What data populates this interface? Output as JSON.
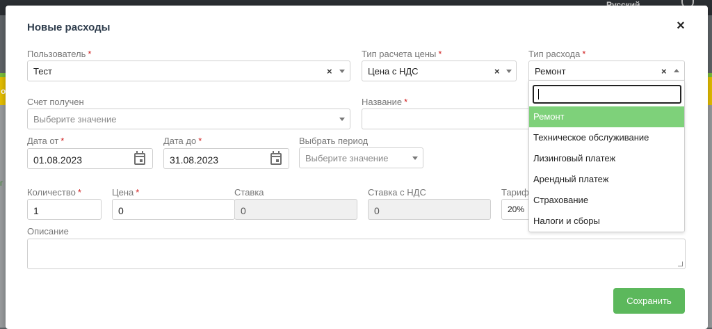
{
  "background": {
    "language_label": "Русский",
    "letter_o": "о",
    "letter_g": "г"
  },
  "modal": {
    "title": "Новые расходы",
    "close_label": "×",
    "required_mark": "*"
  },
  "fields": {
    "user": {
      "label": "Пользователь",
      "value": "Тест"
    },
    "price_type": {
      "label": "Тип расчета цены",
      "value": "Цена с НДС"
    },
    "expense_type": {
      "label": "Тип расхода",
      "value": "Ремонт"
    },
    "invoice": {
      "label": "Счет получен",
      "placeholder": "Выберите значение"
    },
    "name": {
      "label": "Название",
      "value": ""
    },
    "date_from": {
      "label": "Дата от",
      "value": "01.08.2023"
    },
    "date_to": {
      "label": "Дата до",
      "value": "31.08.2023"
    },
    "period": {
      "label": "Выбрать период",
      "placeholder": "Выберите значение"
    },
    "quantity": {
      "label": "Количество",
      "value": "1"
    },
    "price": {
      "label": "Цена",
      "value": "0"
    },
    "rate": {
      "label": "Ставка",
      "value": "0"
    },
    "rate_vat": {
      "label": "Ставка с НДС",
      "value": "0"
    },
    "tariff": {
      "label": "Тариф",
      "value": "20%"
    },
    "description": {
      "label": "Описание",
      "value": ""
    }
  },
  "dropdown": {
    "search_value": "",
    "options": [
      "Ремонт",
      "Техническое обслуживание",
      "Лизинговый платеж",
      "Арендный платеж",
      "Страхование",
      "Налоги и сборы"
    ],
    "selected_index": 0
  },
  "actions": {
    "save_label": "Сохранить",
    "clear_label": "×"
  },
  "colors": {
    "accent_green": "#5cb85c",
    "option_highlight": "#7ed17a",
    "required_red": "#d02020"
  }
}
